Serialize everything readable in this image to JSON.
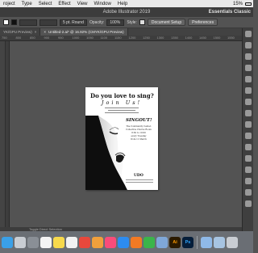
{
  "menubar": {
    "items": [
      "roject",
      "Type",
      "Select",
      "Effect",
      "View",
      "Window",
      "Help"
    ],
    "status": {
      "battery": "15%"
    }
  },
  "titlebar": {
    "title": "Adobe Illustrator 2019",
    "workspace": "Essentials Classic"
  },
  "controlbar": {
    "stroke_style": "5 pt. Round",
    "opacity_label": "Opacity:",
    "opacity_value": "100%",
    "style_label": "Style:",
    "document_setup": "Document Setup",
    "preferences": "Preferences"
  },
  "tabs": [
    {
      "label": "YK/GPU Preview)",
      "close": "×"
    },
    {
      "label": "Untitled-2.ai* @ 16.92% (CMYK/GPU Preview)",
      "close": "×"
    }
  ],
  "ruler": [
    "750",
    "800",
    "850",
    "900",
    "950",
    "1000",
    "1050",
    "1100",
    "1150",
    "1200",
    "1250",
    "1300",
    "1350",
    "1400",
    "1450",
    "1500",
    "1550"
  ],
  "artboard": {
    "headline": "Do you love to sing?",
    "subhead": "Join Us!",
    "singout": "SINGOUT!",
    "info": [
      "The Community Center,",
      "Collective Chorus Room",
      "8:30 to 10:00",
      "every Tuesday",
      "from 11 March"
    ],
    "logo": "UDO"
  },
  "statusbar": {
    "tool": "Toggle Direct Selection"
  },
  "dock": [
    {
      "name": "finder-icon",
      "color": "#3aa0e8",
      "glyph": ""
    },
    {
      "name": "launchpad-icon",
      "color": "#c9cdd3",
      "glyph": ""
    },
    {
      "name": "system-preferences-icon",
      "color": "#8a8f96",
      "glyph": ""
    },
    {
      "name": "calendar-icon",
      "color": "#f4f4f4",
      "glyph": ""
    },
    {
      "name": "notes-icon",
      "color": "#f7d94c",
      "glyph": ""
    },
    {
      "name": "reminders-icon",
      "color": "#f2f2f2",
      "glyph": ""
    },
    {
      "name": "chrome-icon",
      "color": "#e8483c",
      "glyph": ""
    },
    {
      "name": "photos-icon",
      "color": "#f0a03c",
      "glyph": ""
    },
    {
      "name": "music-icon",
      "color": "#f94c7a",
      "glyph": ""
    },
    {
      "name": "app-store-icon",
      "color": "#2d8cf0",
      "glyph": ""
    },
    {
      "name": "firefox-icon",
      "color": "#f27a24",
      "glyph": ""
    },
    {
      "name": "image-capture-icon",
      "color": "#3bb54a",
      "glyph": ""
    },
    {
      "name": "preview-icon",
      "color": "#7fa7d8",
      "glyph": ""
    },
    {
      "name": "illustrator-icon",
      "color": "#2b1a00",
      "glyph": "Ai"
    },
    {
      "name": "photoshop-icon",
      "color": "#061e3a",
      "glyph": "Ps"
    }
  ],
  "dock_right": [
    {
      "name": "downloads-folder-icon",
      "color": "#8fb9e8",
      "glyph": ""
    },
    {
      "name": "documents-folder-icon",
      "color": "#a7c4e2",
      "glyph": ""
    },
    {
      "name": "trash-icon",
      "color": "#c9cdd3",
      "glyph": ""
    }
  ]
}
